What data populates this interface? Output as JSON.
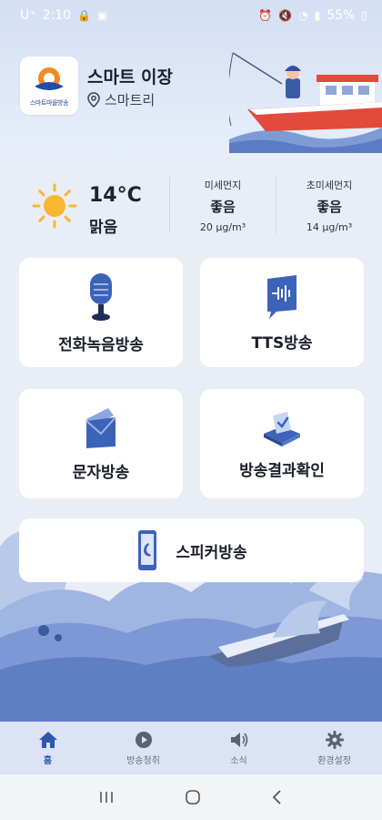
{
  "status_bar": {
    "carrier": "U⁺",
    "time": "2:10",
    "battery": "55%"
  },
  "header": {
    "app_title": "스마트 이장",
    "location": "스마트리",
    "logo_text": "스마트마을방송"
  },
  "weather": {
    "temperature": "14°C",
    "condition": "맑음",
    "fine_dust": {
      "label": "미세먼지",
      "grade": "좋음",
      "value": "20 µg/m³"
    },
    "ultra_fine_dust": {
      "label": "초미세먼지",
      "grade": "좋음",
      "value": "14 µg/m³"
    }
  },
  "tiles": {
    "phone_broadcast": "전화녹음방송",
    "tts_broadcast": "TTS방송",
    "text_broadcast": "문자방송",
    "result_check": "방송결과확인",
    "speaker_broadcast": "스피커방송"
  },
  "bottom_nav": [
    {
      "label": "홈",
      "icon": "home-icon",
      "active": true
    },
    {
      "label": "방송청취",
      "icon": "play-icon",
      "active": false
    },
    {
      "label": "소식",
      "icon": "speaker-icon",
      "active": false
    },
    {
      "label": "환경설정",
      "icon": "gear-icon",
      "active": false
    }
  ],
  "colors": {
    "accent": "#2f56b0",
    "header_bg": "#d4dff4",
    "page_bg": "#e9edf5",
    "sun": "#f7b731"
  }
}
